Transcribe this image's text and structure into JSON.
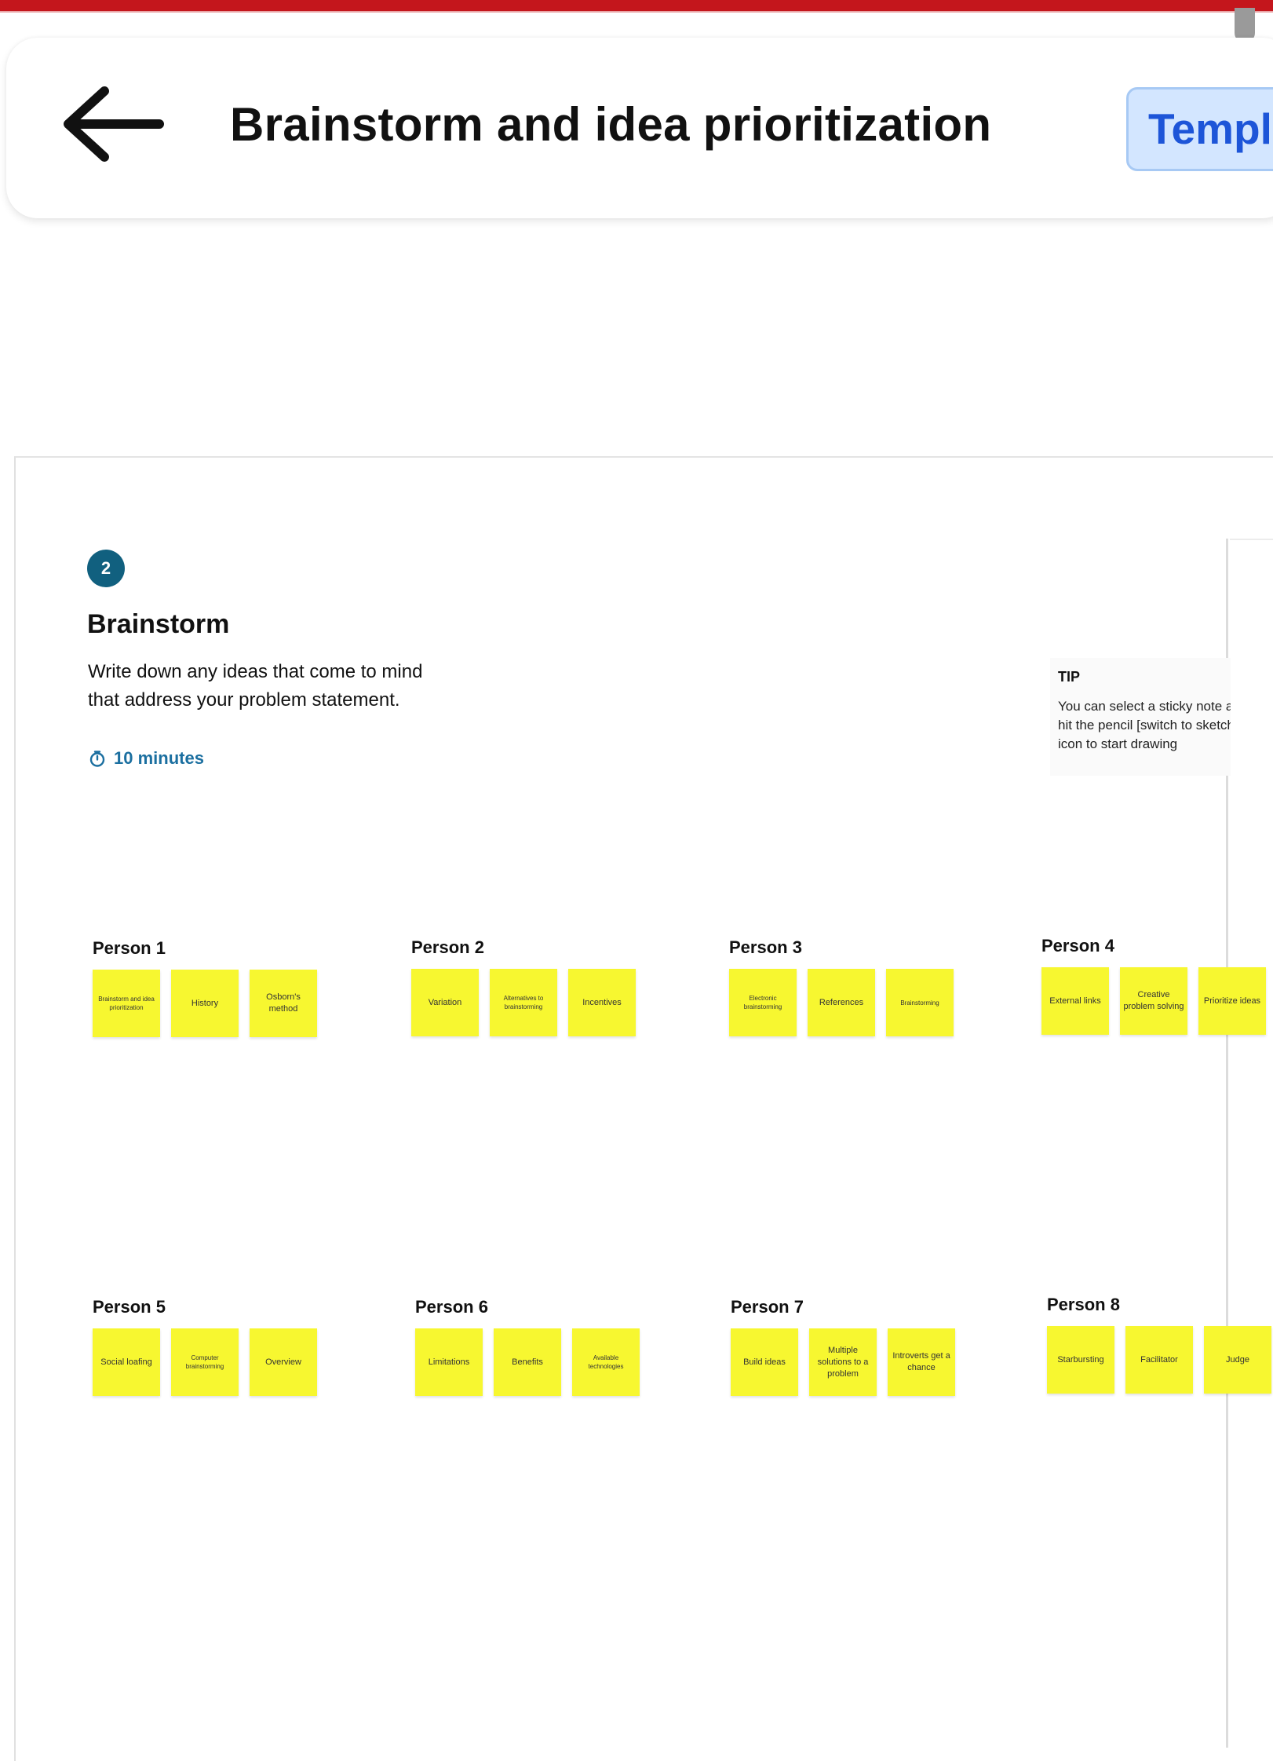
{
  "header": {
    "title": "Brainstorm and idea prioritization",
    "template_button_label": "Templa"
  },
  "section": {
    "step_number": "2",
    "title": "Brainstorm",
    "description_line1": "Write down any ideas that come to mind",
    "description_line2": "that address your problem statement.",
    "timer": "10 minutes"
  },
  "tip": {
    "label": "TIP",
    "text": "You can select a sticky note and hit the pencil [switch to sketch] icon to start drawing"
  },
  "persons": [
    {
      "name": "Person 1",
      "notes": [
        "Brainstorm and idea prioritization",
        "History",
        "Osborn's method"
      ]
    },
    {
      "name": "Person 2",
      "notes": [
        "Variation",
        "Alternatives to brainstorming",
        "Incentives"
      ]
    },
    {
      "name": "Person 3",
      "notes": [
        "Electronic brainstorming",
        "References",
        "Brainstorming"
      ]
    },
    {
      "name": "Person 4",
      "notes": [
        "External links",
        "Creative problem solving",
        "Prioritize ideas"
      ]
    },
    {
      "name": "Person 5",
      "notes": [
        "Social loafing",
        "Computer brainstorming",
        "Overview"
      ]
    },
    {
      "name": "Person 6",
      "notes": [
        "Limitations",
        "Benefits",
        "Available technologies"
      ]
    },
    {
      "name": "Person 7",
      "notes": [
        "Build ideas",
        "Multiple solutions to a problem",
        "Introverts get a chance"
      ]
    },
    {
      "name": "Person 8",
      "notes": [
        "Starbursting",
        "Facilitator",
        "Judge"
      ]
    }
  ]
}
